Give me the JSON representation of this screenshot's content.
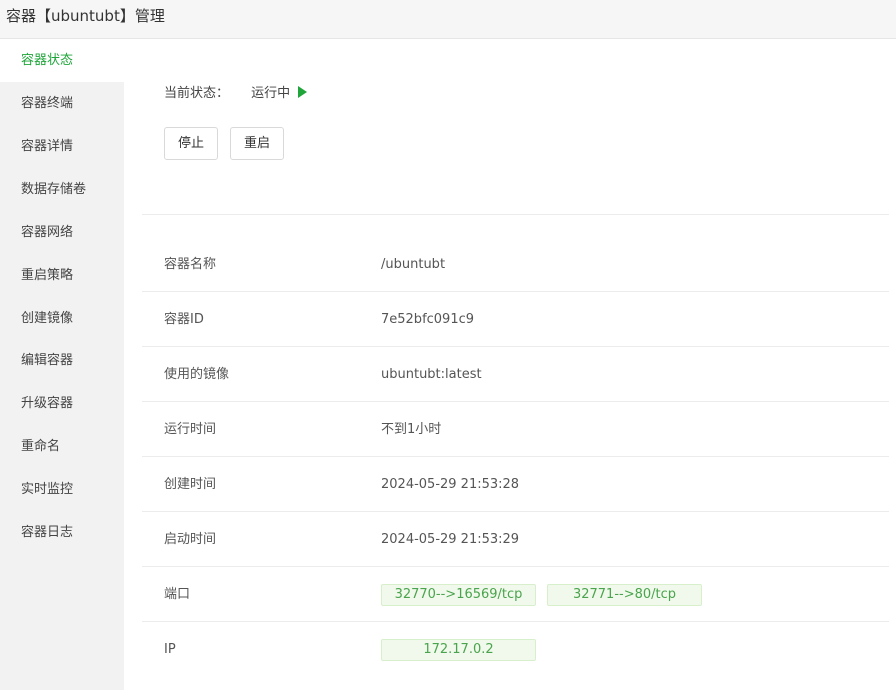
{
  "window": {
    "title": "容器【ubuntubt】管理"
  },
  "sidebar": {
    "items": [
      {
        "label": "容器状态",
        "active": true
      },
      {
        "label": "容器终端"
      },
      {
        "label": "容器详情"
      },
      {
        "label": "数据存储卷"
      },
      {
        "label": "容器网络"
      },
      {
        "label": "重启策略"
      },
      {
        "label": "创建镜像"
      },
      {
        "label": "编辑容器"
      },
      {
        "label": "升级容器"
      },
      {
        "label": "重命名"
      },
      {
        "label": "实时监控"
      },
      {
        "label": "容器日志"
      }
    ]
  },
  "status": {
    "label": "当前状态：",
    "value": "运行中",
    "icon": "play-icon",
    "icon_color": "#20a53a"
  },
  "actions": {
    "stop_label": "停止",
    "restart_label": "重启"
  },
  "info": {
    "name": {
      "key": "容器名称",
      "value": "/ubuntubt"
    },
    "id": {
      "key": "容器ID",
      "value": "7e52bfc091c9"
    },
    "image": {
      "key": "使用的镜像",
      "value": "ubuntubt:latest"
    },
    "uptime": {
      "key": "运行时间",
      "value": "不到1小时"
    },
    "created": {
      "key": "创建时间",
      "value": "2024-05-29 21:53:28"
    },
    "started": {
      "key": "启动时间",
      "value": "2024-05-29 21:53:29"
    },
    "ports": {
      "key": "端口",
      "values": [
        "32770-->16569/tcp",
        "32771-->80/tcp"
      ]
    },
    "ip": {
      "key": "IP",
      "value": "172.17.0.2"
    }
  },
  "colors": {
    "accent": "#20a53a",
    "tag_bg": "#f0f9eb",
    "tag_text": "#4aa44d"
  }
}
